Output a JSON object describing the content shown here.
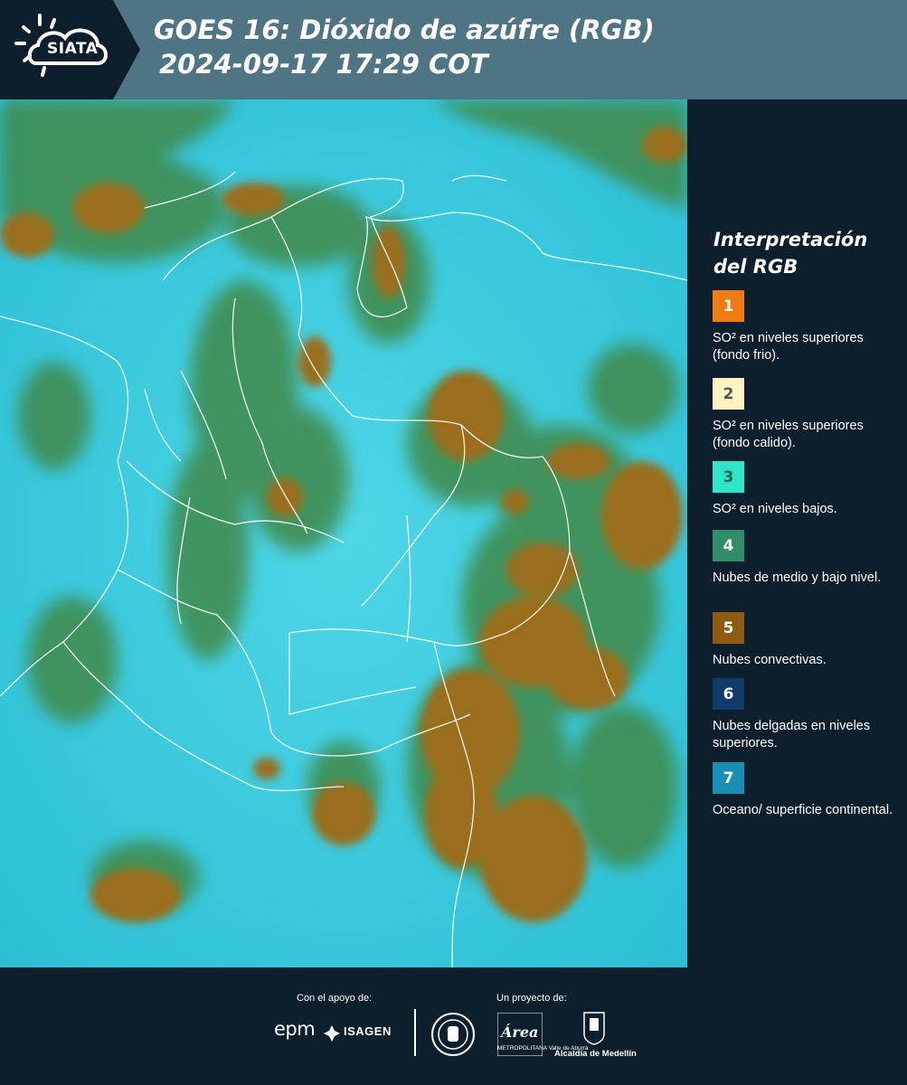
{
  "header": {
    "logo_text": "SIATA",
    "title_line1": "GOES 16: Dióxido de azúfre (RGB)",
    "title_line2": "2024-09-17 17:29 COT"
  },
  "legend": {
    "title": "Interpretación del RGB",
    "items": [
      {
        "number": "1",
        "color": "#f07b13",
        "text_color": "#ffffff",
        "label": "SO² en niveles superiores (fondo frio)."
      },
      {
        "number": "2",
        "color": "#fdf4c2",
        "text_color": "#555555",
        "label": "SO² en niveles superiores (fondo calido)."
      },
      {
        "number": "3",
        "color": "#2ee6c7",
        "text_color": "#2a5f58",
        "label": "SO² en niveles bajos."
      },
      {
        "number": "4",
        "color": "#2f8d67",
        "text_color": "#ffffff",
        "label": "Nubes de medio y bajo nivel."
      },
      {
        "number": "5",
        "color": "#8f5a12",
        "text_color": "#ffffff",
        "label": "Nubes convectivas."
      },
      {
        "number": "6",
        "color": "#0f3a6a",
        "text_color": "#ffffff",
        "label": "Nubes delgadas en niveles superiores."
      },
      {
        "number": "7",
        "color": "#1a8fb3",
        "text_color": "#ffffff",
        "label": "Oceano/ superficie continental."
      }
    ]
  },
  "footer": {
    "support_label": "Con el apoyo de:",
    "project_label": "Un proyecto de:",
    "sponsor1": "epm",
    "sponsor2": "ISAGEN",
    "area_logo_text": "Área",
    "area_subtext": "METROPOLITANA Valle de Aburrá",
    "alcaldia": "Alcaldía de Medellín"
  },
  "map": {
    "description_icon": "satellite-rgb-image",
    "colors": {
      "background": "#34c9dc",
      "cloud_green": "#3d8a45",
      "cloud_brown": "#9a6e1c",
      "border": "#ffffff"
    }
  }
}
